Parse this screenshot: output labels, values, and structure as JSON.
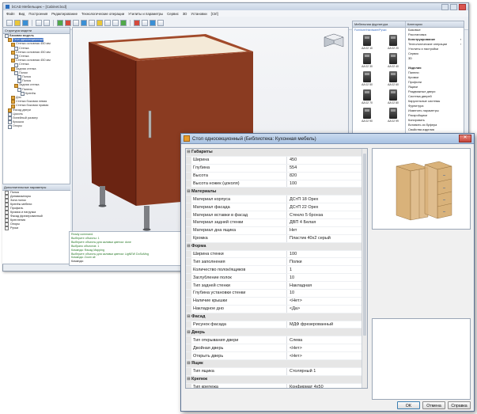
{
  "main_window": {
    "title": "bCAD Мебельщик – [Cabinet.bcd]",
    "menu": [
      "Файл",
      "Вид",
      "Построения",
      "Редактирование",
      "Технологические операции",
      "Утилиты и параметры",
      "Сервис",
      "3D",
      "Установки",
      "[Ctrl]"
    ],
    "tree": {
      "header": "Структура модели",
      "items": [
        {
          "label": "Базовая модель",
          "depth": 0,
          "kind": "group",
          "selected": false
        },
        {
          "label": "Стол односекционный",
          "depth": 1,
          "kind": "comp",
          "selected": true
        },
        {
          "label": "Стенка основная 450 мм",
          "depth": 2,
          "kind": "comp",
          "selected": false
        },
        {
          "label": "Стенка",
          "depth": 3,
          "kind": "item",
          "selected": false
        },
        {
          "label": "Стенка основная 450 мм",
          "depth": 2,
          "kind": "comp",
          "selected": false
        },
        {
          "label": "Стенка",
          "depth": 3,
          "kind": "item",
          "selected": false
        },
        {
          "label": "Стенка основная 450 мм",
          "depth": 2,
          "kind": "comp",
          "selected": false
        },
        {
          "label": "Стенка",
          "depth": 3,
          "kind": "item",
          "selected": false
        },
        {
          "label": "Задняя стенка",
          "depth": 2,
          "kind": "comp",
          "selected": false
        },
        {
          "label": "Полки",
          "depth": 3,
          "kind": "item",
          "selected": false
        },
        {
          "label": "Полка",
          "depth": 4,
          "kind": "item",
          "selected": false
        },
        {
          "label": "Полка",
          "depth": 4,
          "kind": "item",
          "selected": false
        },
        {
          "label": "Задняя стенка",
          "depth": 3,
          "kind": "comp",
          "selected": false
        },
        {
          "label": "Панель",
          "depth": 4,
          "kind": "item",
          "selected": false
        },
        {
          "label": "Крепёж",
          "depth": 5,
          "kind": "item",
          "selected": false
        },
        {
          "label": "Дно",
          "depth": 2,
          "kind": "comp",
          "selected": false
        },
        {
          "label": "Стенка боковая левая",
          "depth": 2,
          "kind": "comp",
          "selected": false
        },
        {
          "label": "Стенка боковая правая",
          "depth": 2,
          "kind": "comp",
          "selected": false
        },
        {
          "label": "Фасад двери",
          "depth": 1,
          "kind": "comp",
          "selected": false
        },
        {
          "label": "Цоколь",
          "depth": 1,
          "kind": "item",
          "selected": false
        },
        {
          "label": "Линейный размер",
          "depth": 1,
          "kind": "item",
          "selected": false
        },
        {
          "label": "Крышка",
          "depth": 1,
          "kind": "item",
          "selected": false
        },
        {
          "label": "Опоры",
          "depth": 1,
          "kind": "item",
          "selected": false
        }
      ]
    },
    "props_panel": {
      "header": "Дополнительные параметры",
      "rows": [
        "Полка",
        "Динамизаторы",
        "Зона полок",
        "Крепёж мебели",
        "Профиль",
        "Кромка и нагрузка",
        "Фасад фрезерованный",
        "Крепления",
        "Опоры",
        "Ручки"
      ]
    },
    "command_lines": [
      {
        "text": "Ready command.",
        "prompt": false
      },
      {
        "text": "Выберите объекты: 1",
        "prompt": false
      },
      {
        "text": "Выберите объекты для заливки цветом: done",
        "prompt": false
      },
      {
        "text": "Выбрано объектов: 1",
        "prompt": false
      },
      {
        "text": "Команда: Фасад Mapping",
        "prompt": false
      },
      {
        "text": "Выберите объекты для заливки цветом: LigNEW DoSuMng",
        "prompt": false
      },
      {
        "text": "Команда: Zoom all",
        "prompt": false
      },
      {
        "text": "Команда:",
        "prompt": true
      }
    ],
    "library": {
      "header": "Мебельная фурнитура",
      "path": "Furniture/Hardware/Ручки",
      "items": [
        "AA 02 10",
        "AA 02 20",
        "AA 02 30",
        "AA 02 40",
        "AA 02 50",
        "AA 02 60",
        "AA 02 70",
        "AA 02 80",
        "AA 02 90",
        "AA 02 99"
      ]
    },
    "categories": {
      "header": "Категории",
      "top": [
        {
          "label": "Базовые",
          "bold": false,
          "arrow": false
        },
        {
          "label": "Расстановка",
          "bold": false,
          "arrow": false
        },
        {
          "label": "Конструирование",
          "bold": true,
          "arrow": true
        },
        {
          "label": "Технологические операции",
          "bold": false,
          "arrow": true
        },
        {
          "label": "Утилиты и настройки",
          "bold": false,
          "arrow": false
        },
        {
          "label": "Сервис",
          "bold": false,
          "arrow": false
        },
        {
          "label": "3D",
          "bold": false,
          "arrow": false
        }
      ],
      "bottom": [
        {
          "label": "Изделия",
          "bold": true,
          "arrow": false
        },
        {
          "label": "Панели",
          "bold": false,
          "arrow": false
        },
        {
          "label": "Кромки",
          "bold": false,
          "arrow": false
        },
        {
          "label": "Профили",
          "bold": false,
          "arrow": false
        },
        {
          "label": "Ящики",
          "bold": false,
          "arrow": false
        },
        {
          "label": "Раздвижные двери",
          "bold": false,
          "arrow": false
        },
        {
          "label": "Система дверей",
          "bold": false,
          "arrow": false
        },
        {
          "label": "Карусельные системы",
          "bold": false,
          "arrow": false
        },
        {
          "label": "Фурнитура",
          "bold": false,
          "arrow": false
        },
        {
          "label": "Изменить параметры",
          "bold": false,
          "arrow": false
        },
        {
          "label": "Раскройщики",
          "bold": false,
          "arrow": false
        },
        {
          "label": "Копировать",
          "bold": false,
          "arrow": false
        },
        {
          "label": "Вставить из буфера",
          "bold": false,
          "arrow": false
        },
        {
          "label": "Свойства изделия",
          "bold": false,
          "arrow": false
        },
        {
          "label": "Удалить в...",
          "bold": false,
          "arrow": false
        },
        {
          "label": "Мультиредактирование",
          "bold": false,
          "arrow": false
        }
      ]
    }
  },
  "dialog": {
    "title": "Стол односекционный (Библиотека: Кухонная мебель)",
    "close_glyph": "✕",
    "rows": [
      {
        "type": "cat",
        "name": "Габариты"
      },
      {
        "type": "prop",
        "name": "Ширина",
        "value": "450"
      },
      {
        "type": "prop",
        "name": "Глубина",
        "value": "554"
      },
      {
        "type": "prop",
        "name": "Высота",
        "value": "820"
      },
      {
        "type": "prop",
        "name": "Высота ножек (цоколя)",
        "value": "100"
      },
      {
        "type": "cat",
        "name": "Материалы"
      },
      {
        "type": "prop",
        "name": "Материал корпуса",
        "value": "ДСтП 18 Орех"
      },
      {
        "type": "prop",
        "name": "Материал фасада",
        "value": "ДСтП 22 Орех"
      },
      {
        "type": "prop",
        "name": "Материал вставки в фасад",
        "value": "Стекло 5 бронза"
      },
      {
        "type": "prop",
        "name": "Материал задней стенки",
        "value": "ДВП 4 Белая"
      },
      {
        "type": "prop",
        "name": "Материал дна ящика",
        "value": "Нет"
      },
      {
        "type": "prop",
        "name": "Кромка",
        "value": "Пластик 40x2 серый"
      },
      {
        "type": "cat",
        "name": "Форма"
      },
      {
        "type": "prop",
        "name": "Ширина стенки",
        "value": "100"
      },
      {
        "type": "prop",
        "name": "Тип заполнения",
        "value": "Полки"
      },
      {
        "type": "prop",
        "name": "Количество полок/ящиков",
        "value": "1"
      },
      {
        "type": "prop",
        "name": "Заглубление полок",
        "value": "10"
      },
      {
        "type": "prop",
        "name": "Тип задней стенки",
        "value": "Накладная"
      },
      {
        "type": "prop",
        "name": "Глубина установки стенки",
        "value": "10"
      },
      {
        "type": "prop",
        "name": "Наличие крышки",
        "value": "<Нет>"
      },
      {
        "type": "prop",
        "name": "Накладное дно",
        "value": "<Да>"
      },
      {
        "type": "cat",
        "name": "Фасад"
      },
      {
        "type": "prop",
        "name": "Рисунок фасада",
        "value": "МДФ фрезерованный"
      },
      {
        "type": "cat",
        "name": "Дверь"
      },
      {
        "type": "prop",
        "name": "Тип открывания двери",
        "value": "Слева"
      },
      {
        "type": "prop",
        "name": "Двойная дверь",
        "value": "<Нет>"
      },
      {
        "type": "prop",
        "name": "Открыть дверь",
        "value": "<Нет>"
      },
      {
        "type": "cat",
        "name": "Ящик"
      },
      {
        "type": "prop",
        "name": "Тип ящика",
        "value": "Столярный 1"
      },
      {
        "type": "cat",
        "name": "Крепеж"
      },
      {
        "type": "prop",
        "name": "Тип крепежа",
        "value": "Конфирмат 4x50"
      },
      {
        "type": "prop",
        "name": "Тип крепежа задней стенки",
        "value": "Гвоздь"
      },
      {
        "type": "prop",
        "name": "Тип крепежа съемной полки",
        "value": "Полкодержатели"
      },
      {
        "type": "cat",
        "name": "Фурнитура"
      },
      {
        "type": "prop",
        "name": "Тип ручки",
        "value": "Скоба С-114 ТF22-G3"
      },
      {
        "type": "prop",
        "name": "Высота установки ручки",
        "value": "80"
      }
    ],
    "buttons": {
      "ok": "OK",
      "cancel": "Отмена",
      "help": "Справка"
    }
  },
  "colors": {
    "wood_dark": "#6b2412",
    "wood_mid": "#8a3b21",
    "wood_light": "#a14a2a",
    "preview_wood": "#d9b27a",
    "accent": "#3b6fc3"
  }
}
